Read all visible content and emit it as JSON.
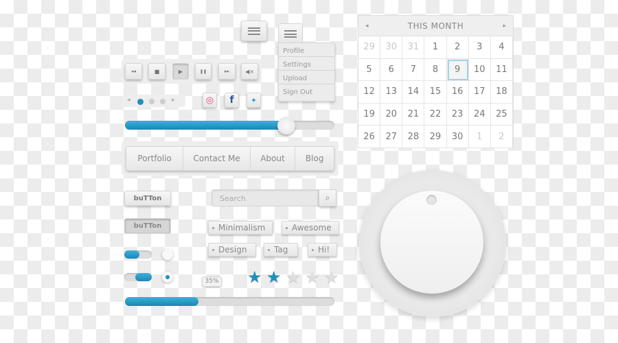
{
  "menu": {
    "items": [
      "Profile",
      "Settings",
      "Upload",
      "Sign Out"
    ]
  },
  "media": {
    "buttons": [
      {
        "icon": "rewind-icon",
        "glyph": "◂◂"
      },
      {
        "icon": "stop-icon",
        "glyph": "■"
      },
      {
        "icon": "play-icon",
        "glyph": "▶"
      },
      {
        "icon": "pause-icon",
        "glyph": "❚❚"
      },
      {
        "icon": "fast-forward-icon",
        "glyph": "▸▸"
      },
      {
        "icon": "mute-icon",
        "glyph": "◀×"
      }
    ]
  },
  "social": {
    "dribbble": "◎",
    "facebook": "f",
    "twitter": "🐦"
  },
  "slider": {
    "value_percent": 77
  },
  "nav": {
    "items": [
      "Portfolio",
      "Contact Me",
      "About",
      "Blog"
    ]
  },
  "buttons": {
    "normal": "buTTon",
    "pressed": "buTTon"
  },
  "search": {
    "placeholder": "Search",
    "icon": "⌕"
  },
  "tags": [
    "Minimalism",
    "Awesome",
    "Design",
    "Tag",
    "Hi!"
  ],
  "rating": {
    "value": 2,
    "max": 5
  },
  "progress": {
    "label": "35%",
    "value_percent": 35
  },
  "toggles": [
    {
      "on": false
    },
    {
      "on": true
    }
  ],
  "radios": [
    {
      "checked": false
    },
    {
      "checked": true
    }
  ],
  "calendar": {
    "title": "THIS MONTH",
    "prev": "◂",
    "next": "▸",
    "selected": "9",
    "days": [
      [
        "29",
        "30",
        "31",
        "1",
        "2",
        "3",
        "4"
      ],
      [
        "5",
        "6",
        "7",
        "8",
        "9",
        "10",
        "11"
      ],
      [
        "12",
        "13",
        "14",
        "15",
        "16",
        "17",
        "18"
      ],
      [
        "19",
        "20",
        "21",
        "22",
        "23",
        "24",
        "25"
      ],
      [
        "26",
        "27",
        "28",
        "29",
        "30",
        "1",
        "2"
      ]
    ]
  },
  "colors": {
    "accent": "#1f8fbf",
    "panel": "#eeeeee",
    "text": "#888888"
  }
}
